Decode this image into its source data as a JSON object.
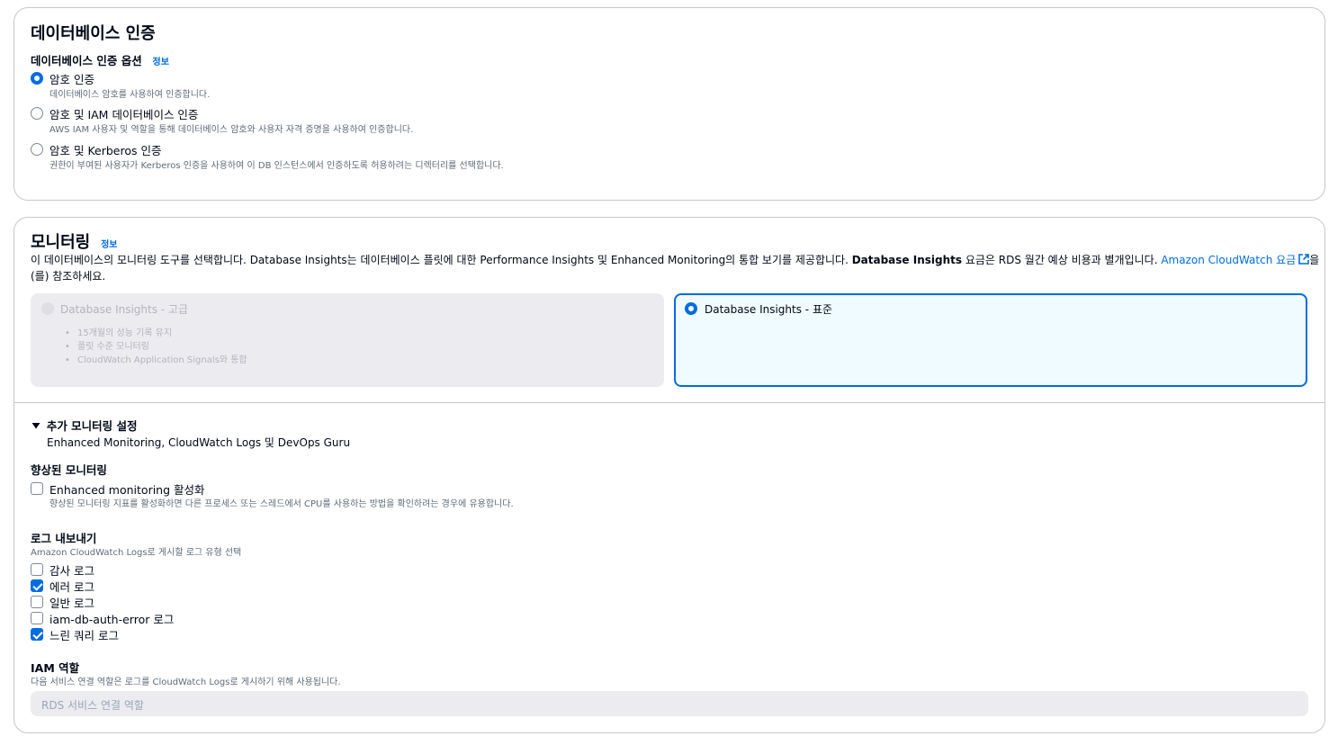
{
  "auth": {
    "title": "데이터베이스 인증",
    "options_label": "데이터베이스 인증 옵션",
    "info": "정보",
    "options": [
      {
        "label": "암호 인증",
        "desc": "데이터베이스 암호를 사용하여 인증합니다.",
        "selected": true
      },
      {
        "label": "암호 및 IAM 데이터베이스 인증",
        "desc": "AWS IAM 사용자 및 역할을 통해 데이터베이스 암호와 사용자 자격 증명을 사용하여 인증합니다.",
        "selected": false
      },
      {
        "label": "암호 및 Kerberos 인증",
        "desc": "권한이 부여된 사용자가 Kerberos 인증을 사용하여 이 DB 인스턴스에서 인증하도록 허용하려는 디렉터리를 선택합니다.",
        "selected": false
      }
    ]
  },
  "monitoring": {
    "title": "모니터링",
    "info": "정보",
    "desc_part1": "이 데이터베이스의 모니터링 도구를 선택합니다. Database Insights는 데이터베이스 플릿에 대한 Performance Insights 및 Enhanced Monitoring의 통합 보기를 제공합니다. ",
    "desc_bold": "Database Insights",
    "desc_part2": " 요금은 RDS 월간 예상 비용과 별개입니다. ",
    "desc_link": "Amazon CloudWatch 요금",
    "desc_part3": "을",
    "desc_line2": "(를) 참조하세요.",
    "tiles": {
      "advanced": {
        "label": "Database Insights - 고급",
        "bullets": [
          "15개월의 성능 기록 유지",
          "플릿 수준 모니터링",
          "CloudWatch Application Signals와 통합"
        ]
      },
      "standard": {
        "label": "Database Insights - 표준",
        "selected": true
      }
    },
    "additional": {
      "title": "추가 모니터링 설정",
      "subtitle": "Enhanced Monitoring, CloudWatch Logs 및 DevOps Guru"
    },
    "enhanced": {
      "heading": "향상된 모니터링",
      "checkbox_label": "Enhanced monitoring 활성화",
      "checkbox_desc": "향상된 모니터링 지표를 활성화하면 다른 프로세스 또는 스레드에서 CPU를 사용하는 방법을 확인하려는 경우에 유용합니다.",
      "checked": false
    },
    "logs": {
      "heading": "로그 내보내기",
      "desc": "Amazon CloudWatch Logs로 게시할 로그 유형 선택",
      "items": [
        {
          "label": "감사 로그",
          "checked": false
        },
        {
          "label": "에러 로그",
          "checked": true
        },
        {
          "label": "일반 로그",
          "checked": false
        },
        {
          "label": "iam-db-auth-error 로그",
          "checked": false
        },
        {
          "label": "느린 쿼리 로그",
          "checked": true
        }
      ]
    },
    "iam_role": {
      "heading": "IAM 역할",
      "desc": "다음 서비스 연결 역할은 로그를 CloudWatch Logs로 게시하기 위해 사용됩니다.",
      "placeholder": "RDS 서비스 연결 역할"
    }
  },
  "colors": {
    "accent": "#006ce0",
    "border": "#c6c6cd",
    "text": "#000716",
    "muted": "#5f6b7a",
    "selected_tile_bg": "#f0fbff",
    "disabled_bg": "#ebebf0"
  }
}
